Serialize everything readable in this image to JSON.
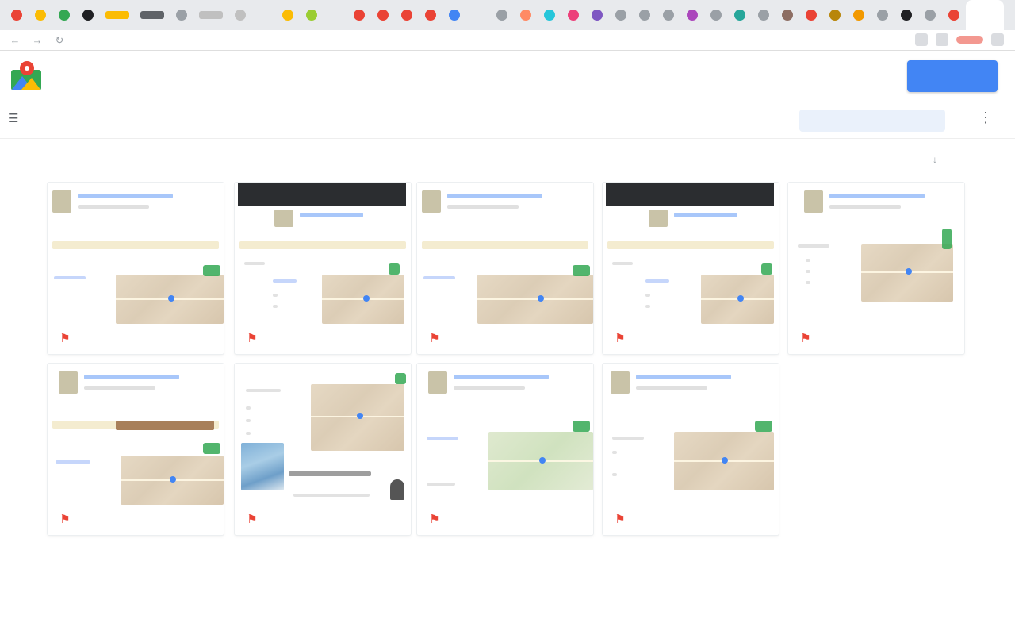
{
  "browser": {
    "tab_colors": [
      "#ea4335",
      "#fbbc04",
      "#34a853",
      "#202124",
      "#fbbc04",
      "#5f6368",
      "#9aa0a6",
      "#c0c0c0",
      "#c0c0c0",
      "#e8eaed",
      "#fbbc04",
      "#9acd32",
      "#e8eaed",
      "#ea4335",
      "#ea4335",
      "#ea4335",
      "#ea4335",
      "#4285f4",
      "#e8eaed",
      "#9aa0a6",
      "#ff8a65",
      "#26c6da",
      "#ec407a",
      "#7e57c2",
      "#9aa0a6",
      "#9aa0a6",
      "#9aa0a6",
      "#ab47bc",
      "#9aa0a6",
      "#26a69a",
      "#9aa0a6",
      "#8d6e63",
      "#ea4335",
      "#b8860b",
      "#f29900",
      "#9aa0a6",
      "#202124",
      "#9aa0a6",
      "#ea4335"
    ],
    "url": "",
    "back_icon": "back-arrow-icon",
    "forward_icon": "forward-arrow-icon",
    "reload_icon": "reload-icon"
  },
  "header": {
    "app_name": "",
    "logo_icon": "maps-logo-icon",
    "help_label": "",
    "primary_button_label": ""
  },
  "toolbar": {
    "menu_icon": "menu-icon",
    "search_placeholder": "",
    "more_icon": "more-vert-icon"
  },
  "content": {
    "breadcrumb": "",
    "sort_label": "",
    "sort_icon": "arrow-down-icon",
    "cards": [
      {
        "title": "",
        "icon": "map-pin-icon"
      },
      {
        "title": "",
        "icon": "map-pin-icon"
      },
      {
        "title": "",
        "icon": "map-pin-icon"
      },
      {
        "title": "",
        "icon": "map-pin-icon"
      },
      {
        "title": "",
        "icon": "map-pin-icon"
      },
      {
        "title": "",
        "icon": "map-pin-icon"
      },
      {
        "title": "",
        "icon": "map-pin-icon"
      },
      {
        "title": "",
        "icon": "map-pin-icon"
      },
      {
        "title": "",
        "icon": "map-pin-icon"
      }
    ]
  },
  "colors": {
    "accent": "#4285f4",
    "pin_red": "#ea4335",
    "badge_green": "#34a853"
  }
}
